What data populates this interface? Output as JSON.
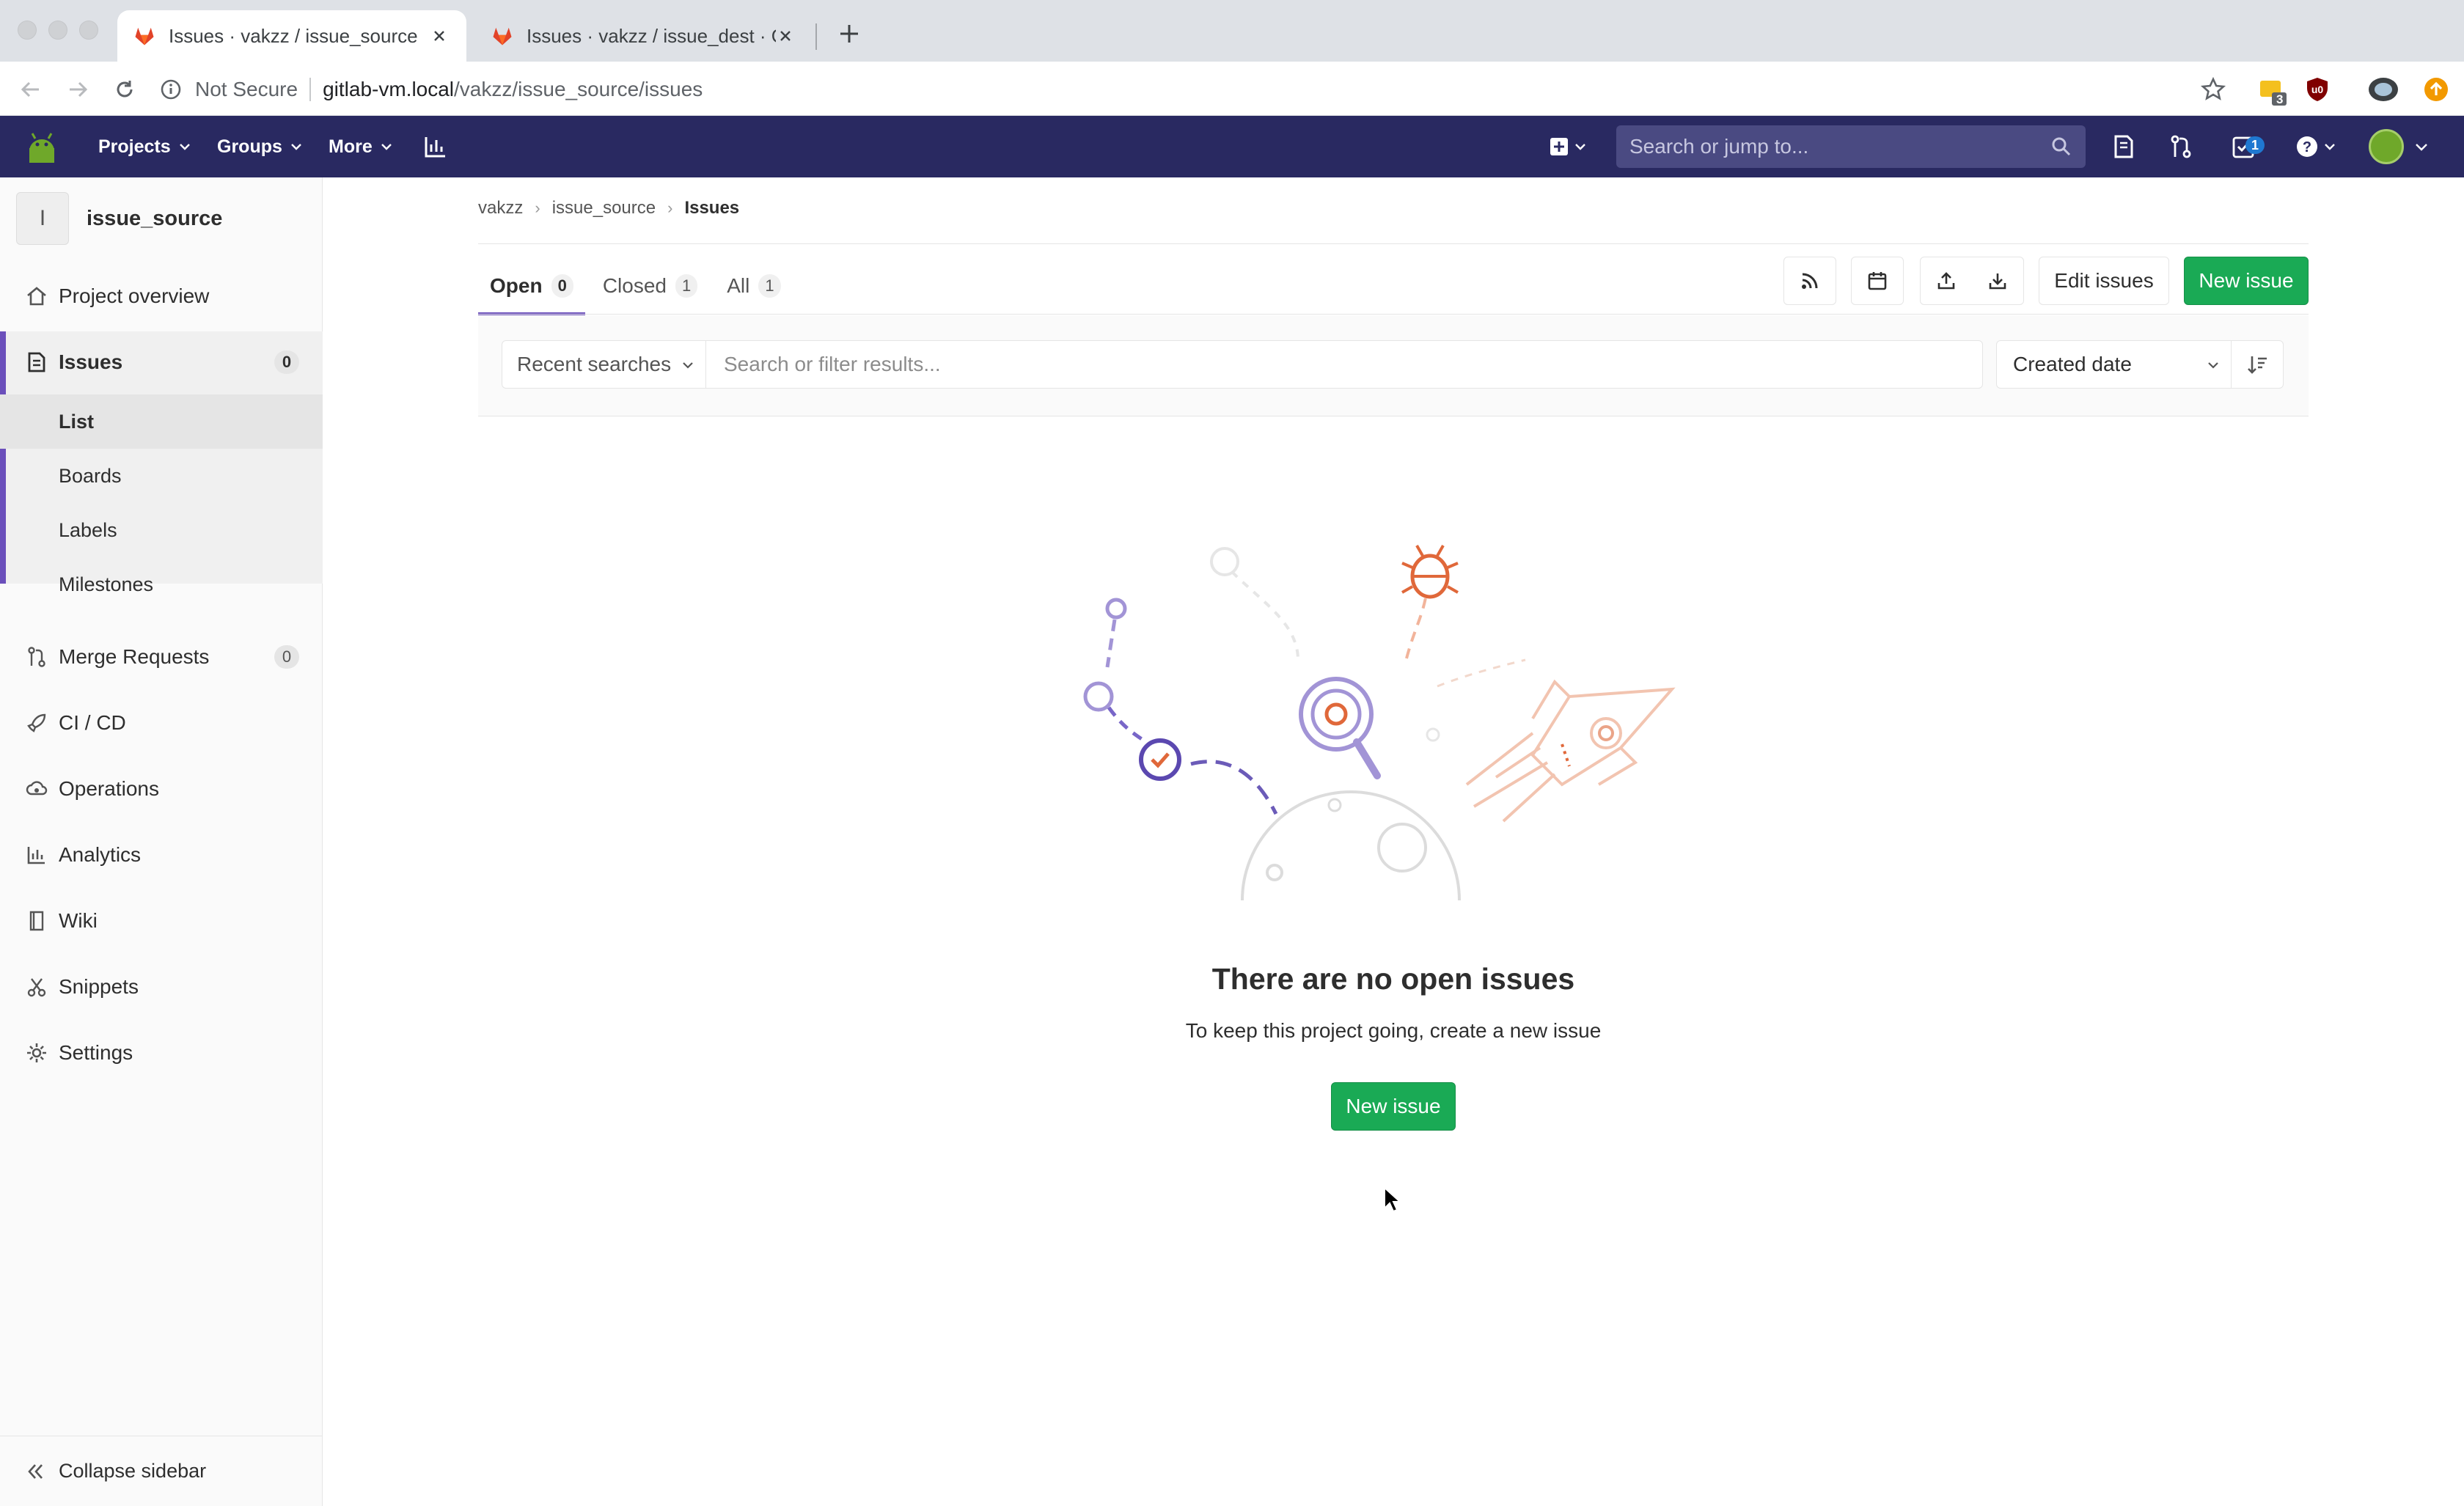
{
  "browser": {
    "tabs": [
      {
        "title": "Issues · vakzz / issue_source · G",
        "active": true
      },
      {
        "title": "Issues · vakzz / issue_dest · GitL",
        "active": false
      }
    ],
    "security_label": "Not Secure",
    "url_host": "gitlab-vm.local",
    "url_path": "/vakzz/issue_source/issues",
    "extension_badge": "3"
  },
  "navbar": {
    "menus": [
      "Projects",
      "Groups",
      "More"
    ],
    "search_placeholder": "Search or jump to...",
    "todo_count": "1"
  },
  "sidebar": {
    "project_initial": "I",
    "project_name": "issue_source",
    "items": [
      {
        "label": "Project overview",
        "icon": "home-icon"
      },
      {
        "label": "Issues",
        "icon": "issues-icon",
        "count": "0"
      },
      {
        "label": "Merge Requests",
        "icon": "merge-request-icon",
        "count": "0"
      },
      {
        "label": "CI / CD",
        "icon": "rocket-icon"
      },
      {
        "label": "Operations",
        "icon": "cloud-gear-icon"
      },
      {
        "label": "Analytics",
        "icon": "chart-icon"
      },
      {
        "label": "Wiki",
        "icon": "book-icon"
      },
      {
        "label": "Snippets",
        "icon": "scissors-icon"
      },
      {
        "label": "Settings",
        "icon": "gear-icon"
      }
    ],
    "issues_sub": [
      "List",
      "Boards",
      "Labels",
      "Milestones"
    ],
    "collapse_label": "Collapse sidebar"
  },
  "breadcrumb": [
    "vakzz",
    "issue_source",
    "Issues"
  ],
  "issue_tabs": [
    {
      "label": "Open",
      "count": "0"
    },
    {
      "label": "Closed",
      "count": "1"
    },
    {
      "label": "All",
      "count": "1"
    }
  ],
  "actions": {
    "edit_issues": "Edit issues",
    "new_issue": "New issue"
  },
  "filter": {
    "recent_searches": "Recent searches",
    "placeholder": "Search or filter results...",
    "sort_by": "Created date"
  },
  "empty_state": {
    "title": "There are no open issues",
    "subtitle": "To keep this project going, create a new issue",
    "button": "New issue"
  },
  "colors": {
    "navbar": "#292961",
    "accent": "#6b4fbb",
    "primary_button": "#1aaa55"
  }
}
